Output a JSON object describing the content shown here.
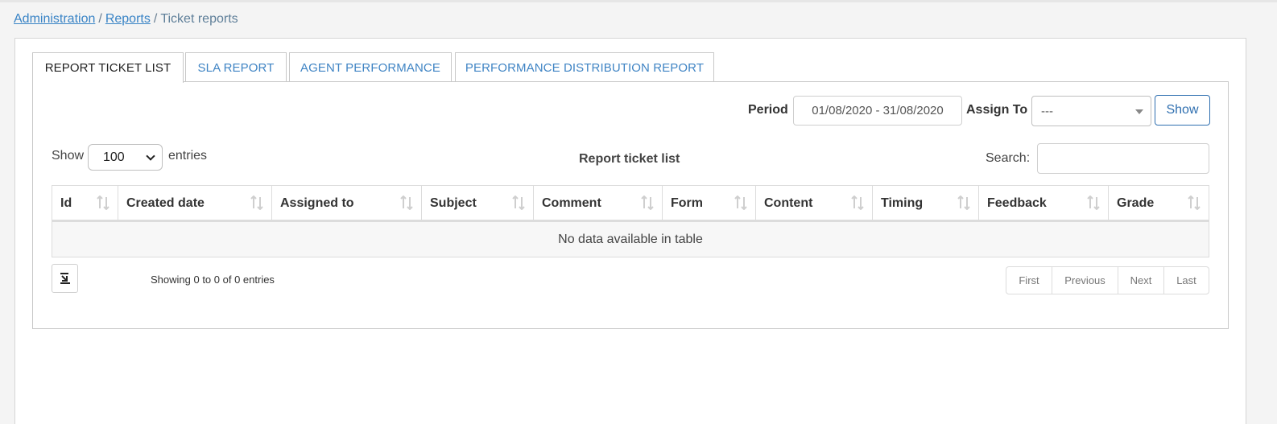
{
  "breadcrumb": {
    "items": [
      "Administration",
      "Reports"
    ],
    "separator": "/",
    "current": "Ticket reports"
  },
  "tabs": [
    {
      "label": "REPORT TICKET LIST",
      "active": true
    },
    {
      "label": "SLA REPORT",
      "active": false
    },
    {
      "label": "AGENT PERFORMANCE",
      "active": false
    },
    {
      "label": "PERFORMANCE DISTRIBUTION REPORT",
      "active": false
    }
  ],
  "filters": {
    "period_label": "Period",
    "period_value": "01/08/2020 - 31/08/2020",
    "assign_label": "Assign To",
    "assign_value": "---",
    "show_label": "Show"
  },
  "table_controls": {
    "show_label": "Show",
    "length_value": "100",
    "entries_label": "entries",
    "title": "Report ticket list",
    "search_label": "Search:",
    "search_value": ""
  },
  "table": {
    "columns": [
      "Id",
      "Created date",
      "Assigned to",
      "Subject",
      "Comment",
      "Form",
      "Content",
      "Timing",
      "Feedback",
      "Grade"
    ],
    "empty_message": "No data available in table"
  },
  "footer": {
    "info": "Showing 0 to 0 of 0 entries",
    "pagination": [
      "First",
      "Previous",
      "Next",
      "Last"
    ],
    "export_icon": "export-icon"
  },
  "colors": {
    "link": "#3a84c6",
    "accent_button": "#2f6fb0"
  }
}
